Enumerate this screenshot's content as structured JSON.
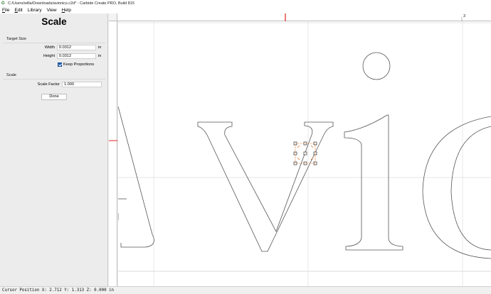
{
  "window": {
    "title": "C:/Users/willa/Downloads/avionics.c2d* - Carbide Create PRO, Build 815"
  },
  "menu": [
    {
      "label": "File",
      "mnemonic": "F",
      "rest": "ile"
    },
    {
      "label": "Edit",
      "mnemonic": "E",
      "rest": "dit"
    },
    {
      "label": "Library",
      "mnemonic": "",
      "rest": "Library"
    },
    {
      "label": "View",
      "mnemonic": "",
      "rest": "View"
    },
    {
      "label": "Help",
      "mnemonic": "H",
      "rest": "elp"
    }
  ],
  "panel": {
    "title": "Scale",
    "target_size": {
      "section_label": "Target Size",
      "width_label": "Width",
      "width_value": "0.0312",
      "width_unit": "in",
      "height_label": "Height",
      "height_value": "0.0312",
      "height_unit": "in",
      "keep_proportions_label": "Keep Proportions",
      "keep_proportions_checked": true
    },
    "scale": {
      "section_label": "Scale",
      "factor_label": "Scale Factor",
      "factor_value": "1.000"
    },
    "done_label": "Done"
  },
  "canvas": {
    "ruler_top_label": "3",
    "design_text": "Avio",
    "accent_color": "#e05a00",
    "ruler_marker_color": "#e02020"
  },
  "status": {
    "text": "Cursor Position X: 2.712 Y: 1.313 Z: 0.000 in"
  }
}
